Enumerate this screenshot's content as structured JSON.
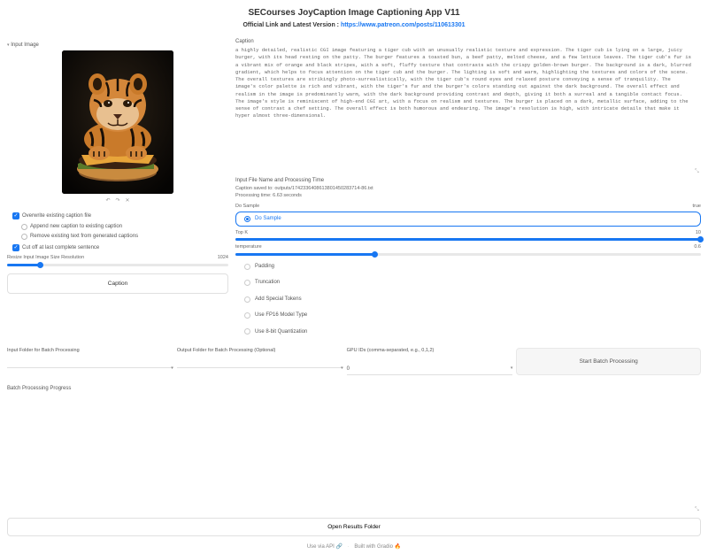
{
  "header": {
    "title": "SECourses JoyCaption Image Captioning App V11",
    "subtitle_prefix": "Official Link and Latest Version : ",
    "subtitle_link": "https://www.patreon.com/posts/110613301"
  },
  "left": {
    "input_image_label": "Input Image",
    "icons": {
      "undo": "undo-icon",
      "redo": "redo-icon",
      "clear": "clear-icon"
    },
    "overwrite": {
      "label": "Overwrite existing caption file",
      "checked": true
    },
    "radios": {
      "append": "Append new caption to existing caption",
      "remove": "Remove existing text from generated captions"
    },
    "cutoff": {
      "label": "Cut off at last complete sentence",
      "checked": true
    },
    "resize_slider": {
      "label": "Resize Input Image Size Resolution",
      "value": 1024
    },
    "caption_btn": "Caption"
  },
  "right": {
    "caption_label": "Caption",
    "caption_text": "a highly detailed, realistic CGI image featuring a tiger cub with an unusually realistic texture and expression. The tiger cub is lying on a large, juicy burger, with its head resting on the patty. The burger features a toasted bun, a beef patty, melted cheese, and a few lettuce leaves. The tiger cub's fur is a vibrant mix of orange and black stripes, with a soft, fluffy texture that contrasts with the crispy golden-brown burger. The background is a dark, blurred gradient, which helps to focus attention on the tiger cub and the burger. The lighting is soft and warm, highlighting the textures and colors of the scene. The overall textures are strikingly photo-surrealistically, with the tiger cub's round eyes and relaxed posture conveying a sense of tranquility. The image's color palette is rich and vibrant, with the tiger's fur and the burger's colors standing out against the dark background. The overall effect and realism in the image is predominantly warm, with the dark background providing contrast and depth, giving it both a surreal and a tangible contact focus. The image's style is reminiscent of high-end CGI art, with a focus on realism and textures. The burger is placed on a dark, metallic surface, adding to the sense of contrast a chef setting. The overall effect is both humorous and endearing. The image's resolution is high, with intricate details that make it hyper almost three-dimensional.",
    "status_label": "Input File Name and Processing Time",
    "status_text": "Caption saved to: outputs/1742336408613801450283714-86.txt\nProcessing time: 6.63 seconds",
    "do_sample_label": "Do Sample",
    "do_sample_value": "true",
    "do_sample_option": "Do Sample",
    "topk": {
      "label": "Top K",
      "value": 10,
      "pct": 100
    },
    "temp": {
      "label": "temperature",
      "value": 0.6,
      "pct": 30
    },
    "radio_options": {
      "padding": "Padding",
      "truncation": "Truncation",
      "add_special": "Add Special Tokens",
      "use_fp16": "Use FP16 Model Type",
      "use_8bit": "Use 8-bit Quantization"
    }
  },
  "batch": {
    "input_folder_label": "Input Folder for Batch Processing",
    "output_folder_label": "Output Folder for Batch Processing (Optional)",
    "ext_label": "GPU IDs (comma-separated, e.g., 0,1,2)",
    "ext_value": "0",
    "start_btn": "Start Batch Processing",
    "progress_label": "Batch Processing Progress",
    "results_btn": "Open Results Folder"
  },
  "footer": {
    "api": "Use via API",
    "gradio": "Built with Gradio"
  }
}
